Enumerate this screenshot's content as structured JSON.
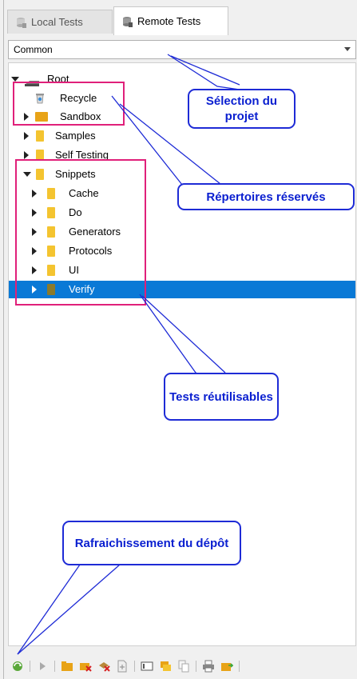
{
  "tabs": [
    {
      "label": "Local Tests",
      "active": false
    },
    {
      "label": "Remote Tests",
      "active": true
    }
  ],
  "project_select": {
    "value": "Common"
  },
  "tree": {
    "root": "Root",
    "items": [
      {
        "label": "Recycle"
      },
      {
        "label": "Sandbox"
      },
      {
        "label": "Samples"
      },
      {
        "label": "Self Testing"
      },
      {
        "label": "Snippets"
      },
      {
        "label": "Cache"
      },
      {
        "label": "Do"
      },
      {
        "label": "Generators"
      },
      {
        "label": "Protocols"
      },
      {
        "label": "UI"
      },
      {
        "label": "Verify"
      }
    ]
  },
  "annotations": {
    "project_selection": "Sélection du projet",
    "reserved_dirs": "Répertoires réservés",
    "reusable_tests": "Tests réutilisables",
    "refresh_repo": "Rafraichissement du dépôt"
  },
  "colors": {
    "selection": "#0a79d6",
    "callout_border": "#1e2bd6",
    "highlight_box": "#e0207a",
    "folder": "#f4c430"
  },
  "toolbar_icons": [
    "refresh-icon",
    "run-icon",
    "new-folder-icon",
    "delete-folder-icon",
    "delete-icon",
    "new-test-icon",
    "rename-icon",
    "move-icon",
    "copy-icon",
    "print-icon",
    "export-icon"
  ]
}
